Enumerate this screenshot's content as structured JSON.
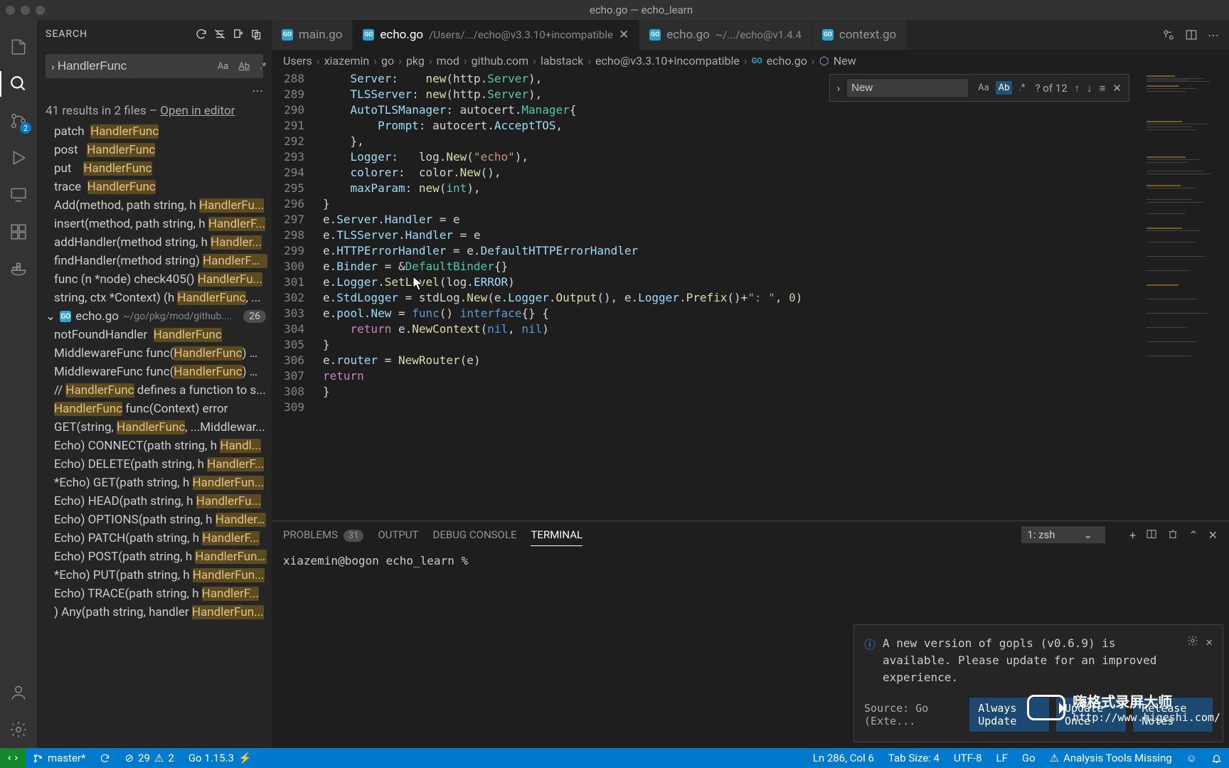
{
  "window": {
    "title": "echo.go — echo_learn"
  },
  "activity": {
    "scm_badge": "2"
  },
  "sidebar": {
    "title": "SEARCH",
    "search_value": "HandlerFunc",
    "results_text_prefix": "41 results in 2 files – ",
    "results_link": "Open in editor",
    "file": {
      "name": "echo.go",
      "path": "~/go/pkg/mod/github....",
      "count": "26"
    }
  },
  "tabs": {
    "t0": {
      "label": "main.go"
    },
    "t1": {
      "label": "echo.go",
      "path": "/Users/.../echo@v3.3.10+incompatible"
    },
    "t2": {
      "label": "echo.go",
      "path": "~/.../echo@v1.4.4"
    },
    "t3": {
      "label": "context.go"
    }
  },
  "breadcrumb": {
    "b0": "Users",
    "b1": "xiazemin",
    "b2": "go",
    "b3": "pkg",
    "b4": "mod",
    "b5": "github.com",
    "b6": "labstack",
    "b7": "echo@v3.3.10+incompatible",
    "b8": "echo.go",
    "b9": "New"
  },
  "lines": {
    "288": "288",
    "289": "289",
    "290": "290",
    "291": "291",
    "292": "292",
    "293": "293",
    "294": "294",
    "295": "295",
    "296": "296",
    "297": "297",
    "298": "298",
    "299": "299",
    "300": "300",
    "301": "301",
    "302": "302",
    "303": "303",
    "304": "304",
    "305": "305",
    "306": "306",
    "307": "307",
    "308": "308",
    "309": "309"
  },
  "find": {
    "value": "New",
    "count": "? of 12"
  },
  "panel": {
    "problems": "PROBLEMS",
    "problems_badge": "31",
    "output": "OUTPUT",
    "debug": "DEBUG CONSOLE",
    "terminal": "TERMINAL",
    "term_select": "1: zsh",
    "prompt": "xiazemin@bogon echo_learn % "
  },
  "notif": {
    "message": "A new version of gopls (v0.6.9) is available. Please update for an improved experience.",
    "source": "Source: Go (Exte...",
    "btn1": "Always Update",
    "btn2": "Update Once",
    "btn3": "Release Notes"
  },
  "watermark": {
    "title": "嗨格式录屏大师",
    "url": "http://www.higeshi.com/"
  },
  "status": {
    "branch": "master*",
    "errors": "29",
    "warnings": "2",
    "go_version": "Go 1.15.3",
    "ln_col": "Ln 286, Col 6",
    "tab_size": "Tab Size: 4",
    "encoding": "UTF-8",
    "eol": "LF",
    "lang": "Go",
    "analysis": "Analysis Tools Missing"
  }
}
